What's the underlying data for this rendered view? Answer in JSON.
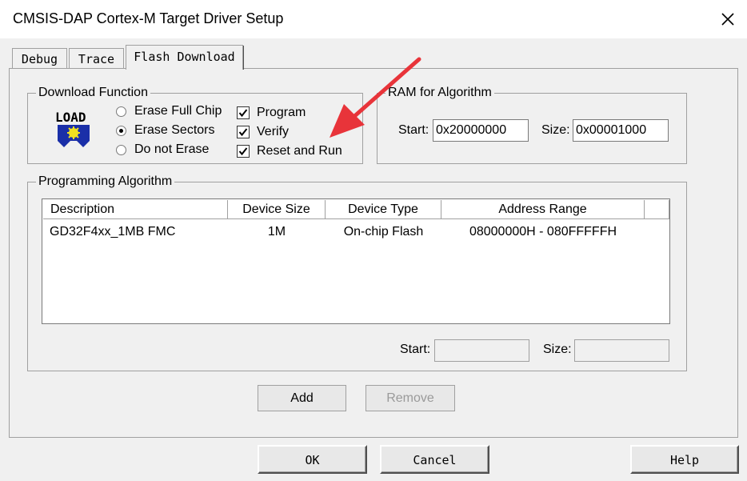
{
  "window": {
    "title": "CMSIS-DAP Cortex-M Target Driver Setup"
  },
  "tabs": [
    {
      "label": "Debug"
    },
    {
      "label": "Trace"
    },
    {
      "label": "Flash Download"
    }
  ],
  "download_function": {
    "legend": "Download Function",
    "logo_text": "LOAD",
    "radios": [
      {
        "label": "Erase Full Chip",
        "selected": false
      },
      {
        "label": "Erase Sectors",
        "selected": true
      },
      {
        "label": "Do not Erase",
        "selected": false
      }
    ],
    "checks": [
      {
        "label": "Program",
        "checked": true
      },
      {
        "label": "Verify",
        "checked": true
      },
      {
        "label": "Reset and Run",
        "checked": true
      }
    ]
  },
  "ram": {
    "legend": "RAM for Algorithm",
    "start_label": "Start:",
    "start_value": "0x20000000",
    "size_label": "Size:",
    "size_value": "0x00001000"
  },
  "programming": {
    "legend": "Programming Algorithm",
    "columns": [
      "Description",
      "Device Size",
      "Device Type",
      "Address Range"
    ],
    "rows": [
      {
        "description": "GD32F4xx_1MB FMC",
        "size": "1M",
        "type": "On-chip Flash",
        "range": "08000000H - 080FFFFFH"
      }
    ],
    "start_label": "Start:",
    "size_label": "Size:",
    "start_value": "",
    "size_value": ""
  },
  "buttons": {
    "add": "Add",
    "remove": "Remove",
    "ok": "OK",
    "cancel": "Cancel",
    "help": "Help"
  },
  "colors": {
    "annotation_arrow": "#e8343a"
  }
}
